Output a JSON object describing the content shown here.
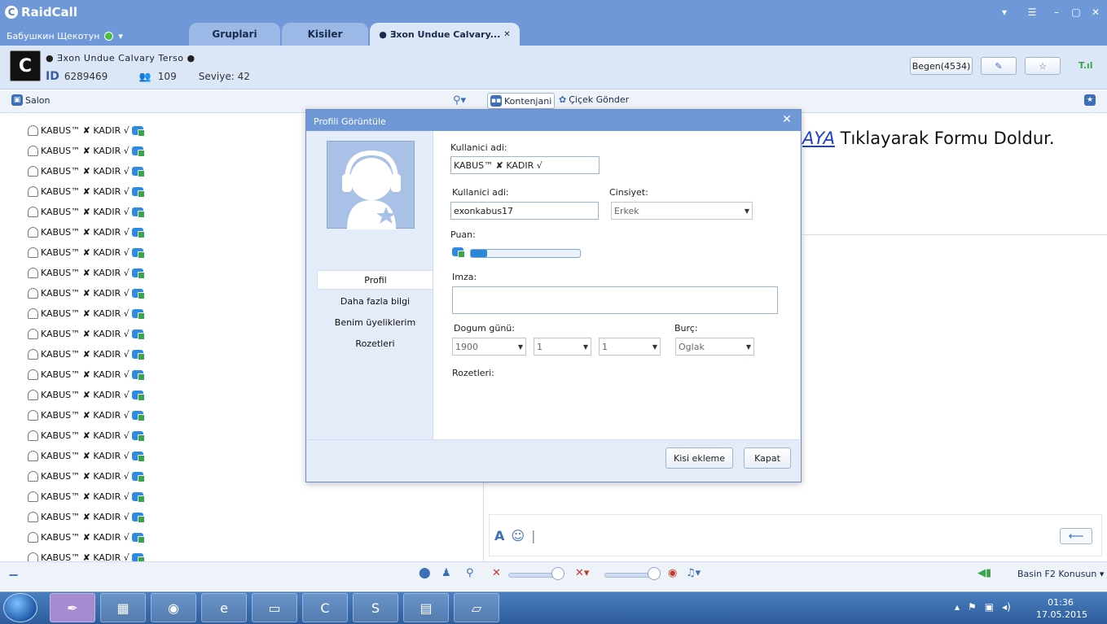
{
  "app": {
    "title": "RaidCall",
    "user": "Бабушкин Щекотун"
  },
  "tabs": [
    {
      "label": "Gruplari"
    },
    {
      "label": "Kisiler"
    },
    {
      "label": "● Ǝxon Undue Calvary..."
    }
  ],
  "channel": {
    "name": "● Ǝxon Undue Calvary Terso ●",
    "logo_text": "C",
    "id_label": "ID",
    "id": "6289469",
    "members": "109",
    "level": "Seviye: 42",
    "like_label": "Begen(4534)"
  },
  "toolbar": {
    "salon": "Salon",
    "contents": "Kontenjani",
    "flower": "Çiçek Gönder"
  },
  "users": [
    "KABUS™ ✘ KADIR √",
    "KABUS™ ✘ KADIR √",
    "KABUS™ ✘ KADIR √",
    "KABUS™ ✘ KADIR √",
    "KABUS™ ✘ KADIR √",
    "KABUS™ ✘ KADIR √",
    "KABUS™ ✘ KADIR √",
    "KABUS™ ✘ KADIR √",
    "KABUS™ ✘ KADIR √",
    "KABUS™ ✘ KADIR √",
    "KABUS™ ✘ KADIR √",
    "KABUS™ ✘ KADIR √",
    "KABUS™ ✘ KADIR √",
    "KABUS™ ✘ KADIR √",
    "KABUS™ ✘ KADIR √",
    "KABUS™ ✘ KADIR √",
    "KABUS™ ✘ KADIR √",
    "KABUS™ ✘ KADIR √",
    "KABUS™ ✘ KADIR √",
    "KABUS™ ✘ KADIR √",
    "KABUS™ ✘ KADIR √",
    "KABUS™ ✘ KADIR √"
  ],
  "chat": {
    "link_text": "AYA",
    "rest_text": " Tıklayarak Formu Doldur."
  },
  "bottom": {
    "talk_label": "Basin F2 Konusun"
  },
  "taskbar": {
    "time": "01:36",
    "date": "17.05.2015"
  },
  "dialog": {
    "title": "Profili Görüntüle",
    "nav": [
      "Profil",
      "Daha fazla bilgi",
      "Benim üyeliklerim",
      "Rozetleri"
    ],
    "username_label": "Kullanici adi:",
    "username_value": "KABUS™ ✘ KADIR √",
    "account_label": "Kullanici adi:",
    "account_value": "exonkabus17",
    "gender_label": "Cinsiyet:",
    "gender_value": "Erkek",
    "points_label": "Puan:",
    "points_progress": 0.15,
    "signature_label": "Imza:",
    "birthday_label": "Dogum günü:",
    "birth_year": "1900",
    "birth_month": "1",
    "birth_day": "1",
    "zodiac_label": "Burç:",
    "zodiac_value": "Oglak",
    "badges_label": "Rozetleri:",
    "add_button": "Kisi ekleme",
    "close_button": "Kapat"
  }
}
